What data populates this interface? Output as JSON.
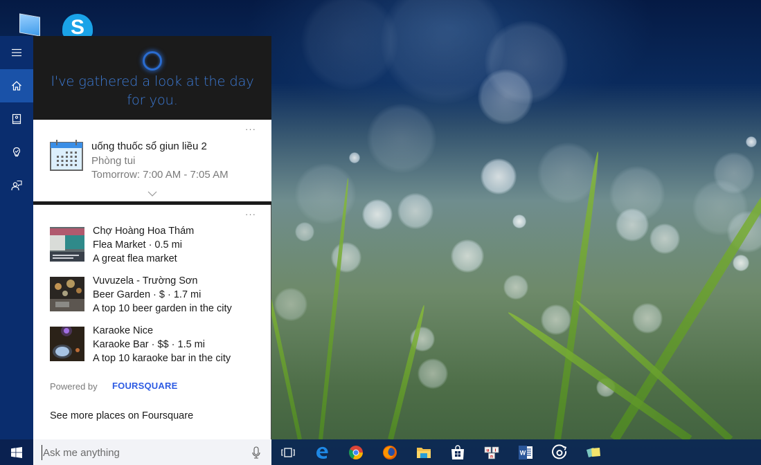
{
  "desktop": {
    "icons": [
      {
        "name": "This PC"
      },
      {
        "name": "Skype",
        "glyph": "S"
      }
    ]
  },
  "rail": {
    "items": [
      {
        "id": "menu",
        "icon": "hamburger-icon"
      },
      {
        "id": "home",
        "icon": "home-icon",
        "active": true
      },
      {
        "id": "notebook",
        "icon": "notebook-icon"
      },
      {
        "id": "reminders",
        "icon": "lightbulb-icon"
      },
      {
        "id": "feedback",
        "icon": "feedback-icon"
      }
    ]
  },
  "cortana": {
    "greeting": "I've gathered a look at the day for you.",
    "accent_color": "#3d7bd6",
    "more_label": "···",
    "event": {
      "title": "uống thuốc sổ giun liều 2",
      "location": "Phòng tui",
      "time": "Tomorrow: 7:00 AM - 7:05 AM"
    },
    "places": [
      {
        "name": "Chợ Hoàng Hoa Thám",
        "meta": "Flea Market · 0.5 mi",
        "desc": "A great flea market"
      },
      {
        "name": "Vuvuzela - Trường Sơn",
        "meta": "Beer Garden · $ · 1.7 mi",
        "desc": "A top 10 beer garden in the city"
      },
      {
        "name": "Karaoke Nice",
        "meta": "Karaoke Bar · $$ · 1.5 mi",
        "desc": "A top 10 karaoke bar in the city"
      }
    ],
    "powered_by": "Powered by",
    "provider": "FOURSQUARE",
    "provider_color": "#2d5be3",
    "see_more": "See more places on Foursquare"
  },
  "taskbar": {
    "search_placeholder": "Ask me anything",
    "apps": [
      {
        "name": "Task View",
        "icon": "task-view-icon"
      },
      {
        "name": "Microsoft Edge",
        "icon": "edge-icon"
      },
      {
        "name": "Google Chrome",
        "icon": "chrome-icon"
      },
      {
        "name": "Firefox",
        "icon": "firefox-icon"
      },
      {
        "name": "File Explorer",
        "icon": "file-explorer-icon"
      },
      {
        "name": "Store",
        "icon": "store-icon"
      },
      {
        "name": "UniKey",
        "icon": "unikey-icon"
      },
      {
        "name": "Word",
        "icon": "word-icon"
      },
      {
        "name": "Groove Music",
        "icon": "groove-icon"
      },
      {
        "name": "Sticky Notes",
        "icon": "sticky-notes-icon"
      }
    ]
  }
}
